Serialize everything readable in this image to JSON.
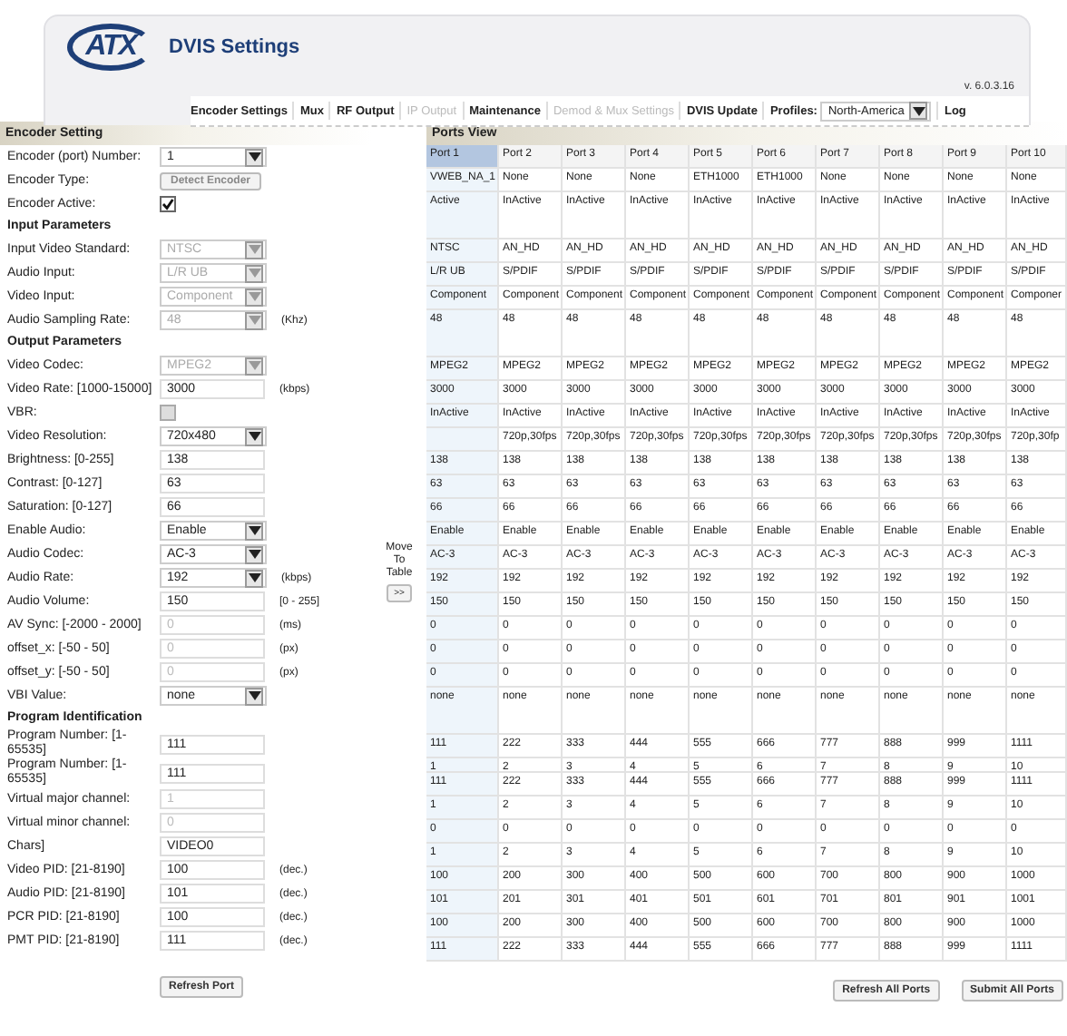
{
  "header": {
    "logo": "ATX",
    "title": "DVIS Settings",
    "version": "v. 6.0.3.16"
  },
  "nav": [
    {
      "kind": "link",
      "label": "Encoder Settings",
      "disabled": false
    },
    {
      "kind": "link",
      "label": "Mux",
      "disabled": false
    },
    {
      "kind": "link",
      "label": "RF Output",
      "disabled": false
    },
    {
      "kind": "link",
      "label": "IP Output",
      "disabled": true
    },
    {
      "kind": "link",
      "label": "Maintenance",
      "disabled": false
    },
    {
      "kind": "link",
      "label": "Demod & Mux Settings",
      "disabled": true
    },
    {
      "kind": "link",
      "label": "DVIS Update",
      "disabled": false
    },
    {
      "kind": "select",
      "label": "Profiles:",
      "value": "North-America",
      "disabled": false
    },
    {
      "kind": "link",
      "label": "Log",
      "disabled": false
    }
  ],
  "encoder": {
    "title": "Encoder Setting",
    "rows": [
      {
        "kind": "select",
        "label": "Encoder (port) Number:",
        "value": "1",
        "disabled": false
      },
      {
        "kind": "button",
        "label": "Encoder Type:",
        "value": "Detect Encoder"
      },
      {
        "kind": "checkbox",
        "label": "Encoder Active:",
        "checked": true,
        "disabled": false
      },
      {
        "kind": "heading",
        "label": "Input Parameters"
      },
      {
        "kind": "select",
        "label": "Input Video Standard:",
        "value": "NTSC",
        "disabled": true
      },
      {
        "kind": "select",
        "label": "Audio Input:",
        "value": "L/R UB",
        "disabled": true
      },
      {
        "kind": "select",
        "label": "Video Input:",
        "value": "Component",
        "disabled": true
      },
      {
        "kind": "select",
        "label": "Audio Sampling Rate:",
        "value": "48",
        "disabled": true,
        "unit": "(Khz)"
      },
      {
        "kind": "heading",
        "label": "Output Parameters"
      },
      {
        "kind": "select",
        "label": "Video Codec:",
        "value": "MPEG2",
        "disabled": true
      },
      {
        "kind": "input",
        "label": "Video Rate: [1000-15000]",
        "value": "3000",
        "disabled": false,
        "unit": "(kbps)"
      },
      {
        "kind": "checkbox",
        "label": "VBR:",
        "checked": false,
        "disabled": true
      },
      {
        "kind": "select",
        "label": "Video Resolution:",
        "value": "720x480",
        "disabled": false
      },
      {
        "kind": "input",
        "label": "Brightness: [0-255]",
        "value": "138",
        "disabled": false
      },
      {
        "kind": "input",
        "label": "Contrast: [0-127]",
        "value": "63",
        "disabled": false
      },
      {
        "kind": "input",
        "label": "Saturation: [0-127]",
        "value": "66",
        "disabled": false
      },
      {
        "kind": "select",
        "label": "Enable Audio:",
        "value": "Enable",
        "disabled": false
      },
      {
        "kind": "select",
        "label": "Audio Codec:",
        "value": "AC-3",
        "disabled": false
      },
      {
        "kind": "select",
        "label": "Audio Rate:",
        "value": "192",
        "disabled": false,
        "unit": "(kbps)"
      },
      {
        "kind": "input",
        "label": "Audio Volume:",
        "value": "150",
        "disabled": false,
        "unit": "[0 - 255]"
      },
      {
        "kind": "input",
        "label": "AV Sync: [-2000 - 2000]",
        "value": "0",
        "disabled": true,
        "unit": "(ms)"
      },
      {
        "kind": "input",
        "label": "offset_x: [-50 - 50]",
        "value": "0",
        "disabled": true,
        "unit": "(px)"
      },
      {
        "kind": "input",
        "label": "offset_y: [-50 - 50]",
        "value": "0",
        "disabled": true,
        "unit": "(px)"
      },
      {
        "kind": "select",
        "label": "VBI Value:",
        "value": "none",
        "disabled": false
      },
      {
        "kind": "heading",
        "label": "Program Identification"
      },
      {
        "kind": "input",
        "label": "Program Number: [1-65535]",
        "value": "111",
        "disabled": false
      },
      {
        "kind": "input",
        "label": "Program Number: [1-65535]",
        "value": "111",
        "disabled": false
      },
      {
        "kind": "input",
        "label": "Virtual major channel:",
        "value": "1",
        "disabled": true
      },
      {
        "kind": "input",
        "label": "Virtual minor channel:",
        "value": "0",
        "disabled": true
      },
      {
        "kind": "input",
        "label": "Chars]",
        "value": "VIDEO0",
        "disabled": false
      },
      {
        "kind": "input",
        "label": "Video PID: [21-8190]",
        "value": "100",
        "disabled": false,
        "unit": "(dec.)"
      },
      {
        "kind": "input",
        "label": "Audio PID: [21-8190]",
        "value": "101",
        "disabled": false,
        "unit": "(dec.)"
      },
      {
        "kind": "input",
        "label": "PCR PID: [21-8190]",
        "value": "100",
        "disabled": false,
        "unit": "(dec.)"
      },
      {
        "kind": "input",
        "label": "PMT PID: [21-8190]",
        "value": "111",
        "disabled": false,
        "unit": "(dec.)"
      }
    ],
    "refresh_button": "Refresh Port"
  },
  "move": {
    "label": "Move To Table",
    "button": ">>"
  },
  "ports": {
    "title": "Ports View",
    "columns": [
      {
        "label": "Port 1",
        "selected": true
      },
      {
        "label": "Port 2",
        "selected": false
      },
      {
        "label": "Port 3",
        "selected": false
      },
      {
        "label": "Port 4",
        "selected": false
      },
      {
        "label": "Port 5",
        "selected": false
      },
      {
        "label": "Port 6",
        "selected": false
      },
      {
        "label": "Port 7",
        "selected": false
      },
      {
        "label": "Port 8",
        "selected": false
      },
      {
        "label": "Port 9",
        "selected": false
      },
      {
        "label": "Port 10",
        "selected": false
      }
    ],
    "rows": [
      {
        "kind": "normal",
        "cells": [
          "VWEB_NA_1",
          "None",
          "None",
          "None",
          "ETH1000",
          "ETH1000",
          "None",
          "None",
          "None",
          "None"
        ]
      },
      {
        "kind": "tall",
        "cells": [
          "Active",
          "InActive",
          "InActive",
          "InActive",
          "InActive",
          "InActive",
          "InActive",
          "InActive",
          "InActive",
          "InActive"
        ]
      },
      {
        "kind": "normal",
        "cells": [
          "NTSC",
          "AN_HD",
          "AN_HD",
          "AN_HD",
          "AN_HD",
          "AN_HD",
          "AN_HD",
          "AN_HD",
          "AN_HD",
          "AN_HD"
        ]
      },
      {
        "kind": "normal",
        "cells": [
          "L/R UB",
          "S/PDIF",
          "S/PDIF",
          "S/PDIF",
          "S/PDIF",
          "S/PDIF",
          "S/PDIF",
          "S/PDIF",
          "S/PDIF",
          "S/PDIF"
        ]
      },
      {
        "kind": "normal",
        "cells": [
          "Component",
          "Component",
          "Component",
          "Component",
          "Component",
          "Component",
          "Component",
          "Component",
          "Component",
          "Componer"
        ]
      },
      {
        "kind": "tall",
        "cells": [
          "48",
          "48",
          "48",
          "48",
          "48",
          "48",
          "48",
          "48",
          "48",
          "48"
        ]
      },
      {
        "kind": "normal",
        "cells": [
          "MPEG2",
          "MPEG2",
          "MPEG2",
          "MPEG2",
          "MPEG2",
          "MPEG2",
          "MPEG2",
          "MPEG2",
          "MPEG2",
          "MPEG2"
        ]
      },
      {
        "kind": "normal",
        "cells": [
          "3000",
          "3000",
          "3000",
          "3000",
          "3000",
          "3000",
          "3000",
          "3000",
          "3000",
          "3000"
        ]
      },
      {
        "kind": "normal",
        "cells": [
          "InActive",
          "InActive",
          "InActive",
          "InActive",
          "InActive",
          "InActive",
          "InActive",
          "InActive",
          "InActive",
          "InActive"
        ]
      },
      {
        "kind": "normal",
        "cells": [
          null,
          "720p,30fps",
          "720p,30fps",
          "720p,30fps",
          "720p,30fps",
          "720p,30fps",
          "720p,30fps",
          "720p,30fps",
          "720p,30fps",
          "720p,30fp"
        ]
      },
      {
        "kind": "normal",
        "cells": [
          "138",
          "138",
          "138",
          "138",
          "138",
          "138",
          "138",
          "138",
          "138",
          "138"
        ]
      },
      {
        "kind": "normal",
        "cells": [
          "63",
          "63",
          "63",
          "63",
          "63",
          "63",
          "63",
          "63",
          "63",
          "63"
        ]
      },
      {
        "kind": "normal",
        "cells": [
          "66",
          "66",
          "66",
          "66",
          "66",
          "66",
          "66",
          "66",
          "66",
          "66"
        ]
      },
      {
        "kind": "normal",
        "cells": [
          "Enable",
          "Enable",
          "Enable",
          "Enable",
          "Enable",
          "Enable",
          "Enable",
          "Enable",
          "Enable",
          "Enable"
        ]
      },
      {
        "kind": "normal",
        "cells": [
          "AC-3",
          "AC-3",
          "AC-3",
          "AC-3",
          "AC-3",
          "AC-3",
          "AC-3",
          "AC-3",
          "AC-3",
          "AC-3"
        ]
      },
      {
        "kind": "normal",
        "cells": [
          "192",
          "192",
          "192",
          "192",
          "192",
          "192",
          "192",
          "192",
          "192",
          "192"
        ]
      },
      {
        "kind": "normal",
        "cells": [
          "150",
          "150",
          "150",
          "150",
          "150",
          "150",
          "150",
          "150",
          "150",
          "150"
        ]
      },
      {
        "kind": "normal",
        "cells": [
          "0",
          "0",
          "0",
          "0",
          "0",
          "0",
          "0",
          "0",
          "0",
          "0"
        ]
      },
      {
        "kind": "normal",
        "cells": [
          "0",
          "0",
          "0",
          "0",
          "0",
          "0",
          "0",
          "0",
          "0",
          "0"
        ]
      },
      {
        "kind": "normal",
        "cells": [
          "0",
          "0",
          "0",
          "0",
          "0",
          "0",
          "0",
          "0",
          "0",
          "0"
        ]
      },
      {
        "kind": "tall",
        "cells": [
          "none",
          "none",
          "none",
          "none",
          "none",
          "none",
          "none",
          "none",
          "none",
          "none"
        ]
      },
      {
        "kind": "normal",
        "cells": [
          "111",
          "222",
          "333",
          "444",
          "555",
          "666",
          "777",
          "888",
          "999",
          "1111"
        ]
      },
      {
        "kind": "short",
        "cells": [
          "1",
          "2",
          "3",
          "4",
          "5",
          "6",
          "7",
          "8",
          "9",
          "10"
        ]
      },
      {
        "kind": "normal",
        "cells": [
          "111",
          "222",
          "333",
          "444",
          "555",
          "666",
          "777",
          "888",
          "999",
          "1111"
        ]
      },
      {
        "kind": "normal",
        "cells": [
          "1",
          "2",
          "3",
          "4",
          "5",
          "6",
          "7",
          "8",
          "9",
          "10"
        ]
      },
      {
        "kind": "normal",
        "cells": [
          "0",
          "0",
          "0",
          "0",
          "0",
          "0",
          "0",
          "0",
          "0",
          "0"
        ]
      },
      {
        "kind": "normal",
        "cells": [
          "1",
          "2",
          "3",
          "4",
          "5",
          "6",
          "7",
          "8",
          "9",
          "10"
        ]
      },
      {
        "kind": "normal",
        "cells": [
          "100",
          "200",
          "300",
          "400",
          "500",
          "600",
          "700",
          "800",
          "900",
          "1000"
        ]
      },
      {
        "kind": "normal",
        "cells": [
          "101",
          "201",
          "301",
          "401",
          "501",
          "601",
          "701",
          "801",
          "901",
          "1001"
        ]
      },
      {
        "kind": "normal",
        "cells": [
          "100",
          "200",
          "300",
          "400",
          "500",
          "600",
          "700",
          "800",
          "900",
          "1000"
        ]
      },
      {
        "kind": "normal",
        "cells": [
          "111",
          "222",
          "333",
          "444",
          "555",
          "666",
          "777",
          "888",
          "999",
          "1111"
        ]
      }
    ],
    "buttons": [
      "Refresh All Ports",
      "Submit All Ports"
    ]
  }
}
